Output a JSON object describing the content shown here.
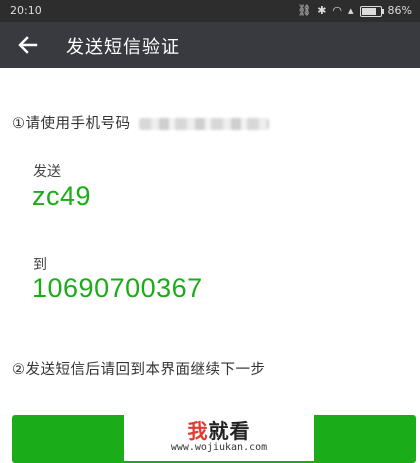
{
  "status_bar": {
    "time": "20:10",
    "icons": [
      "link-icon",
      "bluetooth-icon",
      "wifi-icon",
      "signal-icon",
      "battery-icon"
    ],
    "battery_text": "86%"
  },
  "nav": {
    "back_icon": "back-arrow-icon",
    "title": "发送短信验证"
  },
  "content": {
    "step1_text": "①请使用手机号码",
    "send_label": "发送",
    "code": "zc49",
    "to_label": "到",
    "number": "10690700367",
    "step2_text": "②发送短信后请回到本界面继续下一步"
  },
  "watermark": {
    "title_first": "我",
    "title_rest": "就看",
    "url": "www.wojiukan.com"
  },
  "colors": {
    "accent_green": "#1aad19",
    "nav_bg": "#393a3f",
    "status_bg": "#2d2d2d"
  }
}
